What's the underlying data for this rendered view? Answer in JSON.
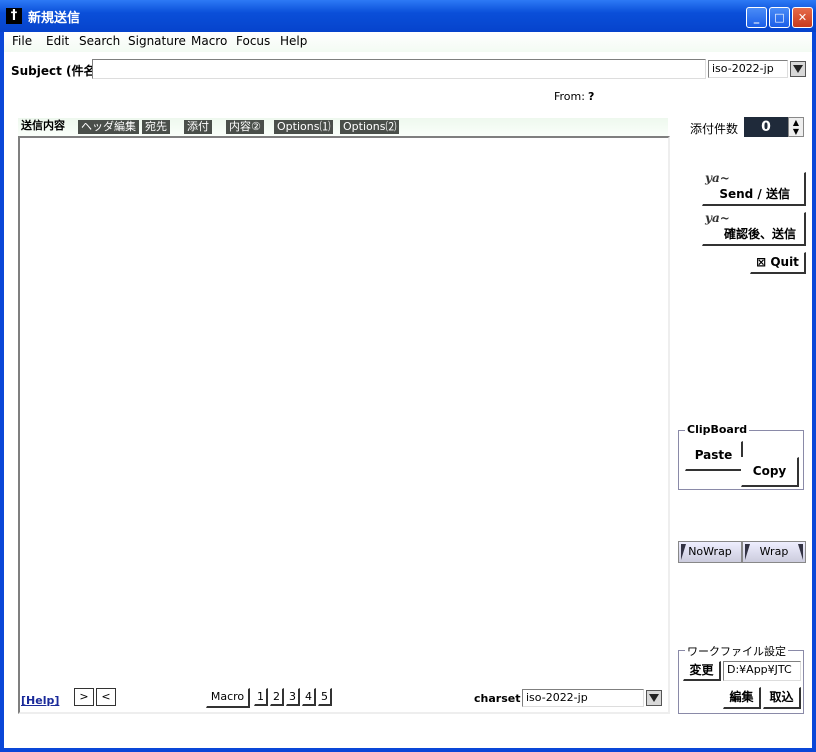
{
  "window": {
    "title": "新規送信"
  },
  "menu": [
    "File",
    "Edit",
    "Search",
    "Signature",
    "Macro",
    "Focus",
    "Help"
  ],
  "subject": {
    "label": "Subject (件名)",
    "value": "",
    "charset": "iso-2022-jp"
  },
  "from": {
    "label": "From:",
    "value": "?"
  },
  "tabs": [
    "送信内容",
    "ヘッダ編集",
    "宛先",
    "添付",
    "内容②",
    "Options⑴",
    "Options⑵"
  ],
  "attach": {
    "label": "添付件数",
    "count": "0"
  },
  "actions": {
    "send": "Send / 送信",
    "confirm_send": "確認後、送信",
    "quit": "Quit"
  },
  "clipboard": {
    "label": "ClipBoard",
    "paste": "Paste",
    "copy": "Copy"
  },
  "wrap": {
    "nowrap": "NoWrap",
    "wrap": "Wrap"
  },
  "workfile": {
    "label": "ワークファイル設定",
    "change": "変更",
    "path": "D:¥App¥JTC",
    "edit": "編集",
    "import": "取込"
  },
  "bottom": {
    "help": "[Help]",
    "next": ">",
    "prev": "<",
    "macro": "Macro",
    "macro_nums": [
      "1",
      "2",
      "3",
      "4",
      "5"
    ],
    "charset_label": "charset",
    "charset": "iso-2022-jp"
  }
}
